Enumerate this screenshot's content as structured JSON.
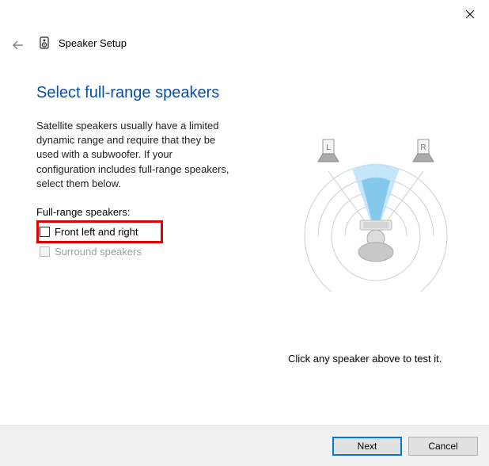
{
  "window": {
    "title": "Speaker Setup"
  },
  "page": {
    "heading": "Select full-range speakers",
    "description": "Satellite speakers usually have a limited dynamic range and require that they be used with a subwoofer.  If your configuration includes full-range speakers, select them below.",
    "subsection_label": "Full-range speakers:",
    "checkbox1_label": "Front left and right",
    "checkbox2_label": "Surround speakers",
    "hint": "Click any speaker above to test it."
  },
  "diagram": {
    "left_label": "L",
    "right_label": "R"
  },
  "buttons": {
    "next": "Next",
    "cancel": "Cancel"
  }
}
